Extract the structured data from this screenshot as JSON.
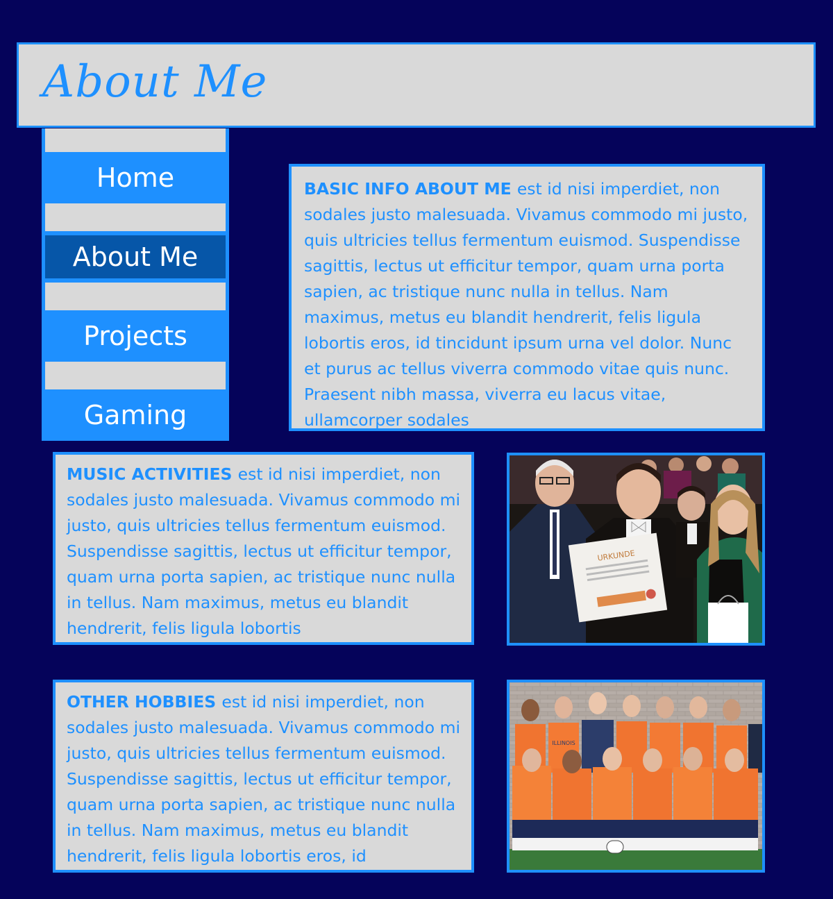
{
  "header": {
    "title": "About Me"
  },
  "nav": {
    "items": [
      {
        "label": "Home",
        "active": false
      },
      {
        "label": "About Me",
        "active": true
      },
      {
        "label": "Projects",
        "active": false
      },
      {
        "label": "Gaming",
        "active": false
      }
    ]
  },
  "sections": {
    "basic": {
      "heading": "BASIC INFO ABOUT ME",
      "body": "est id nisi imperdiet, non sodales justo malesuada. Vivamus commodo mi justo, quis ultricies tellus fermentum euismod. Suspendisse sagittis, lectus ut efficitur tempor, quam urna porta sapien, ac tristique nunc nulla in tellus. Nam maximus, metus eu blandit hendrerit, felis ligula lobortis eros, id tincidunt ipsum urna vel dolor. Nunc et purus ac tellus viverra commodo vitae quis nunc. Praesent nibh massa, viverra eu lacus vitae, ullamcorper sodales"
    },
    "music": {
      "heading": "MUSIC ACTIVITIES",
      "body": "est id nisi imperdiet, non sodales justo malesuada. Vivamus commodo mi justo, quis ultricies tellus fermentum euismod. Suspendisse sagittis, lectus ut efficitur tempor, quam urna porta sapien, ac tristique nunc nulla in tellus. Nam maximus, metus eu blandit hendrerit, felis ligula lobortis"
    },
    "hobbies": {
      "heading": "OTHER HOBBIES",
      "body": "est id nisi imperdiet, non sodales justo malesuada. Vivamus commodo mi justo, quis ultricies tellus fermentum euismod. Suspendisse sagittis, lectus ut efficitur tempor, quam urna porta sapien, ac tristique nunc nulla in tellus. Nam maximus, metus eu blandit hendrerit, felis ligula lobortis eros, id"
    }
  },
  "photos": {
    "music": {
      "certificate_text": "URKUNDE"
    },
    "sports": {
      "jersey_text": "ILLINOIS"
    }
  },
  "colors": {
    "background": "#05035a",
    "accent": "#1e90ff",
    "panel": "#d9d9d9",
    "active_nav": "#0656a8"
  }
}
